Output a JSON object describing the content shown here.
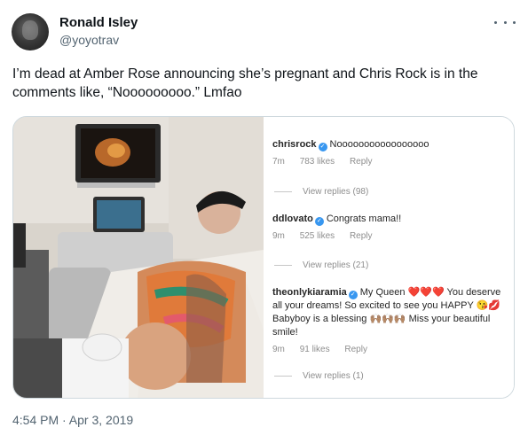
{
  "author": {
    "display_name": "Ronald Isley",
    "handle": "@yoyotrav"
  },
  "tweet": {
    "text": "I’m dead at Amber Rose announcing she’s pregnant and Chris Rock is in the comments like, “Nooooooooo.” Lmfao",
    "timestamp": "4:54 PM · Apr 3, 2019"
  },
  "icons": {
    "more": "more-dots-icon",
    "verified": "verified-badge-icon"
  },
  "colors": {
    "verified": "#3897f0",
    "meta_text": "#8e8e8e",
    "border": "#cfd9de"
  },
  "comments": [
    {
      "user": "chrisrock",
      "text": "Nooooooooooooooooo",
      "age": "7m",
      "likes": "783 likes",
      "reply": "Reply",
      "view_replies": "View replies (98)"
    },
    {
      "user": "ddlovato",
      "text": "Congrats mama!!",
      "age": "9m",
      "likes": "525 likes",
      "reply": "Reply",
      "view_replies": "View replies (21)"
    },
    {
      "user": "theonlykiaramia",
      "text_1": "My Queen",
      "hearts": "❤️❤️❤️",
      "text_2": "You deserve all your dreams! So excited to see you HAPPY",
      "emoji_1": "😘💋",
      "text_3": "Babyboy is a blessing",
      "emoji_2": "🙌🏽🙌🏽🙌🏽",
      "text_4": "Miss your beautiful smile!",
      "age": "9m",
      "likes": "91 likes",
      "reply": "Reply",
      "view_replies": "View replies (1)"
    }
  ]
}
